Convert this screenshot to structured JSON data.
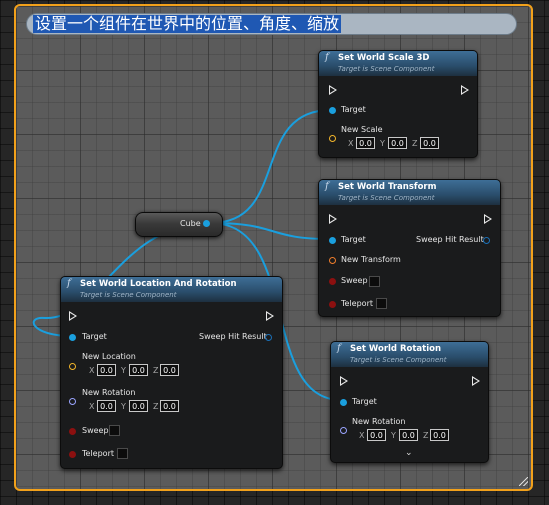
{
  "comment": {
    "title": "设置一个组件在世界中的位置、角度、缩放"
  },
  "cube_node": {
    "label": "Cube"
  },
  "axes": {
    "x": "X",
    "y": "Y",
    "z": "Z"
  },
  "scale_node": {
    "icon": "function-icon",
    "title": "Set World Scale 3D",
    "subtitle": "Target is Scene Component",
    "target_label": "Target",
    "param_label": "New Scale",
    "values": [
      "0.0",
      "0.0",
      "0.0"
    ]
  },
  "transform_node": {
    "icon": "function-icon",
    "title": "Set World Transform",
    "subtitle": "Target is Scene Component",
    "target_label": "Target",
    "output_label": "Sweep Hit Result",
    "param_label": "New Transform",
    "sweep_label": "Sweep",
    "teleport_label": "Teleport"
  },
  "locrot_node": {
    "icon": "function-icon",
    "title": "Set World Location And Rotation",
    "subtitle": "Target is Scene Component",
    "target_label": "Target",
    "output_label": "Sweep Hit Result",
    "location_label": "New Location",
    "location_values": [
      "0.0",
      "0.0",
      "0.0"
    ],
    "rotation_label": "New Rotation",
    "rotation_values": [
      "0.0",
      "0.0",
      "0.0"
    ],
    "sweep_label": "Sweep",
    "teleport_label": "Teleport"
  },
  "rotation_node": {
    "icon": "function-icon",
    "title": "Set World Rotation",
    "subtitle": "Target is Scene Component",
    "target_label": "Target",
    "param_label": "New Rotation",
    "values": [
      "0.0",
      "0.0",
      "0.0"
    ],
    "expand_icon": "chevron-down-icon"
  },
  "colors": {
    "comment_border": "#f2a11b",
    "wire": "#1a9fde",
    "header": "#3e6e96"
  }
}
